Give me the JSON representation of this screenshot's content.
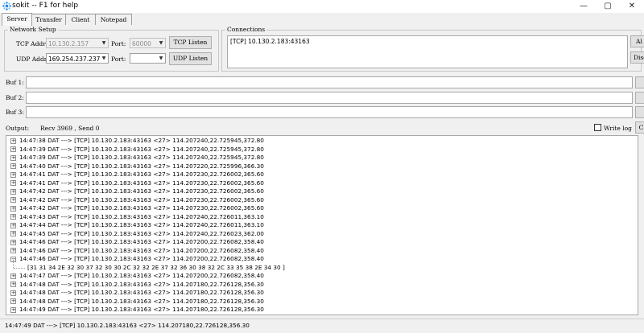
{
  "window": {
    "title": "sokit -- F1 for help",
    "minimize_glyph": "—",
    "maximize_glyph": "▢",
    "close_glyph": "✕"
  },
  "tabs": [
    {
      "label": "Server",
      "active": true
    },
    {
      "label": "Transfer",
      "active": false
    },
    {
      "label": "Client",
      "active": false
    },
    {
      "label": "Notepad",
      "active": false
    }
  ],
  "network_setup": {
    "title": "Network Setup",
    "tcp_addr_label": "TCP Addr:",
    "tcp_addr_value": "10.130.2.157",
    "tcp_port_label": "Port:",
    "tcp_port_value": "60000",
    "tcp_listen_label": "TCP Listen",
    "udp_addr_label": "UDP Addr:",
    "udp_addr_value": "169.254.237.237",
    "udp_port_label": "Port:",
    "udp_port_value": "",
    "udp_listen_label": "UDP Listen"
  },
  "connections": {
    "title": "Connections",
    "items": [
      "[TCP] 10.130.2.183:43163"
    ],
    "side_button_1": "Al",
    "side_button_2": "Disc"
  },
  "buffers": [
    {
      "label": "Buf 1:"
    },
    {
      "label": "Buf 2:"
    },
    {
      "label": "Buf 3:"
    }
  ],
  "output": {
    "label": "Output:",
    "stats": "Recv 3969 , Send 0",
    "write_log_label": "Write log",
    "write_log_checked": false,
    "side_button": "C"
  },
  "log": {
    "collapsed_glyph": "+",
    "expanded_glyph": "−",
    "rows": [
      {
        "text": "14:47:38 DAT ---> [TCP] 10.130.2.183:43163 <27> 114.207240,22.725945,372.80",
        "expanded": false
      },
      {
        "text": "14:47:39 DAT ---> [TCP] 10.130.2.183:43163 <27> 114.207240,22.725945,372.80",
        "expanded": false
      },
      {
        "text": "14:47:39 DAT ---> [TCP] 10.130.2.183:43163 <27> 114.207240,22.725945,372.80",
        "expanded": false
      },
      {
        "text": "14:47:40 DAT ---> [TCP] 10.130.2.183:43163 <27> 114.207220,22.725996,366.30",
        "expanded": false
      },
      {
        "text": "14:47:41 DAT ---> [TCP] 10.130.2.183:43163 <27> 114.207230,22.726002,365.60",
        "expanded": false
      },
      {
        "text": "14:47:41 DAT ---> [TCP] 10.130.2.183:43163 <27> 114.207230,22.726002,365.60",
        "expanded": false
      },
      {
        "text": "14:47:42 DAT ---> [TCP] 10.130.2.183:43163 <27> 114.207230,22.726002,365.60",
        "expanded": false
      },
      {
        "text": "14:47:42 DAT ---> [TCP] 10.130.2.183:43163 <27> 114.207230,22.726002,365.60",
        "expanded": false
      },
      {
        "text": "14:47:42 DAT ---> [TCP] 10.130.2.183:43163 <27> 114.207230,22.726002,365.60",
        "expanded": false
      },
      {
        "text": "14:47:43 DAT ---> [TCP] 10.130.2.183:43163 <27> 114.207240,22.726011,363.10",
        "expanded": false
      },
      {
        "text": "14:47:44 DAT ---> [TCP] 10.130.2.183:43163 <27> 114.207240,22.726011,363.10",
        "expanded": false
      },
      {
        "text": "14:47:45 DAT ---> [TCP] 10.130.2.183:43163 <27> 114.207240,22.726023,362.00",
        "expanded": false
      },
      {
        "text": "14:47:46 DAT ---> [TCP] 10.130.2.183:43163 <27> 114.207200,22.726082,358.40",
        "expanded": false
      },
      {
        "text": "14:47:46 DAT ---> [TCP] 10.130.2.183:43163 <27> 114.207200,22.726082,358.40",
        "expanded": false
      },
      {
        "text": "14:47:46 DAT ---> [TCP] 10.130.2.183:43163 <27> 114.207200,22.726082,358.40",
        "expanded": true
      },
      {
        "text": "[31 31 34 2E 32 30 37 32 30 30 2C 32 32 2E 37 32 36 30 38 32 2C 33 35 38 2E 34 30 ]",
        "child": true
      },
      {
        "text": "14:47:47 DAT ---> [TCP] 10.130.2.183:43163 <27> 114.207200,22.726082,358.40",
        "expanded": false
      },
      {
        "text": "14:47:48 DAT ---> [TCP] 10.130.2.183:43163 <27> 114.207180,22.726128,356.30",
        "expanded": false
      },
      {
        "text": "14:47:48 DAT ---> [TCP] 10.130.2.183:43163 <27> 114.207180,22.726128,356.30",
        "expanded": false
      },
      {
        "text": "14:47:48 DAT ---> [TCP] 10.130.2.183:43163 <27> 114.207180,22.726128,356.30",
        "expanded": false
      },
      {
        "text": "14:47:49 DAT ---> [TCP] 10.130.2.183:43163 <27> 114.207180,22.726128,356.30",
        "expanded": false
      }
    ]
  },
  "status_bar": {
    "text": "14:47:49 DAT ---> [TCP] 10.130.2.183:43163 <27> 114.207180,22.726128,356.30"
  }
}
